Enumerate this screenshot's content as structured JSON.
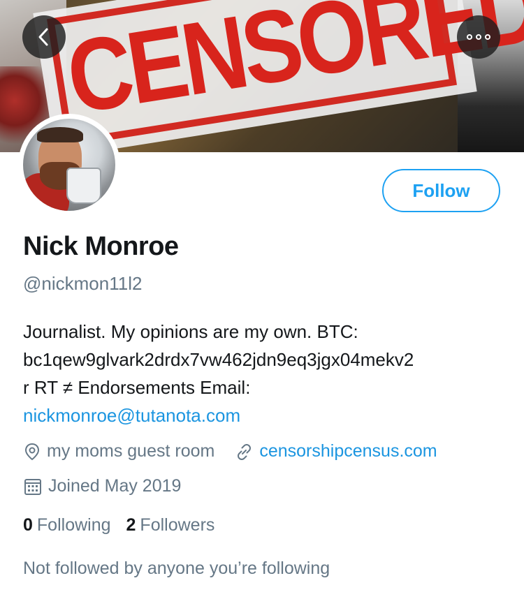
{
  "header": {
    "banner_text": "CENSORED!",
    "back_icon": "chevron-left-icon",
    "more_icon": "more-horizontal-icon"
  },
  "profile": {
    "name": "Nick Monroe",
    "handle": "@nickmon11l2",
    "follow_label": "Follow",
    "bio": {
      "line1": "Journalist. My opinions are my own. BTC:",
      "line2": "bc1qew9glvark2drdx7vw462jdn9eq3jgx04mekv2",
      "line3": "r RT ≠ Endorsements Email:",
      "email": "nickmonroe@tutanota.com"
    },
    "location": "my moms guest room",
    "website": "censorshipcensus.com",
    "joined": "Joined May 2019",
    "following_count": "0",
    "following_label": "Following",
    "followers_count": "2",
    "followers_label": "Followers",
    "social_context": "Not followed by anyone you’re following"
  },
  "colors": {
    "accent": "#1da1f2",
    "link": "#1b95e0",
    "secondary_text": "#657786",
    "primary_text": "#14171a",
    "stamp_red": "#d8241c"
  }
}
